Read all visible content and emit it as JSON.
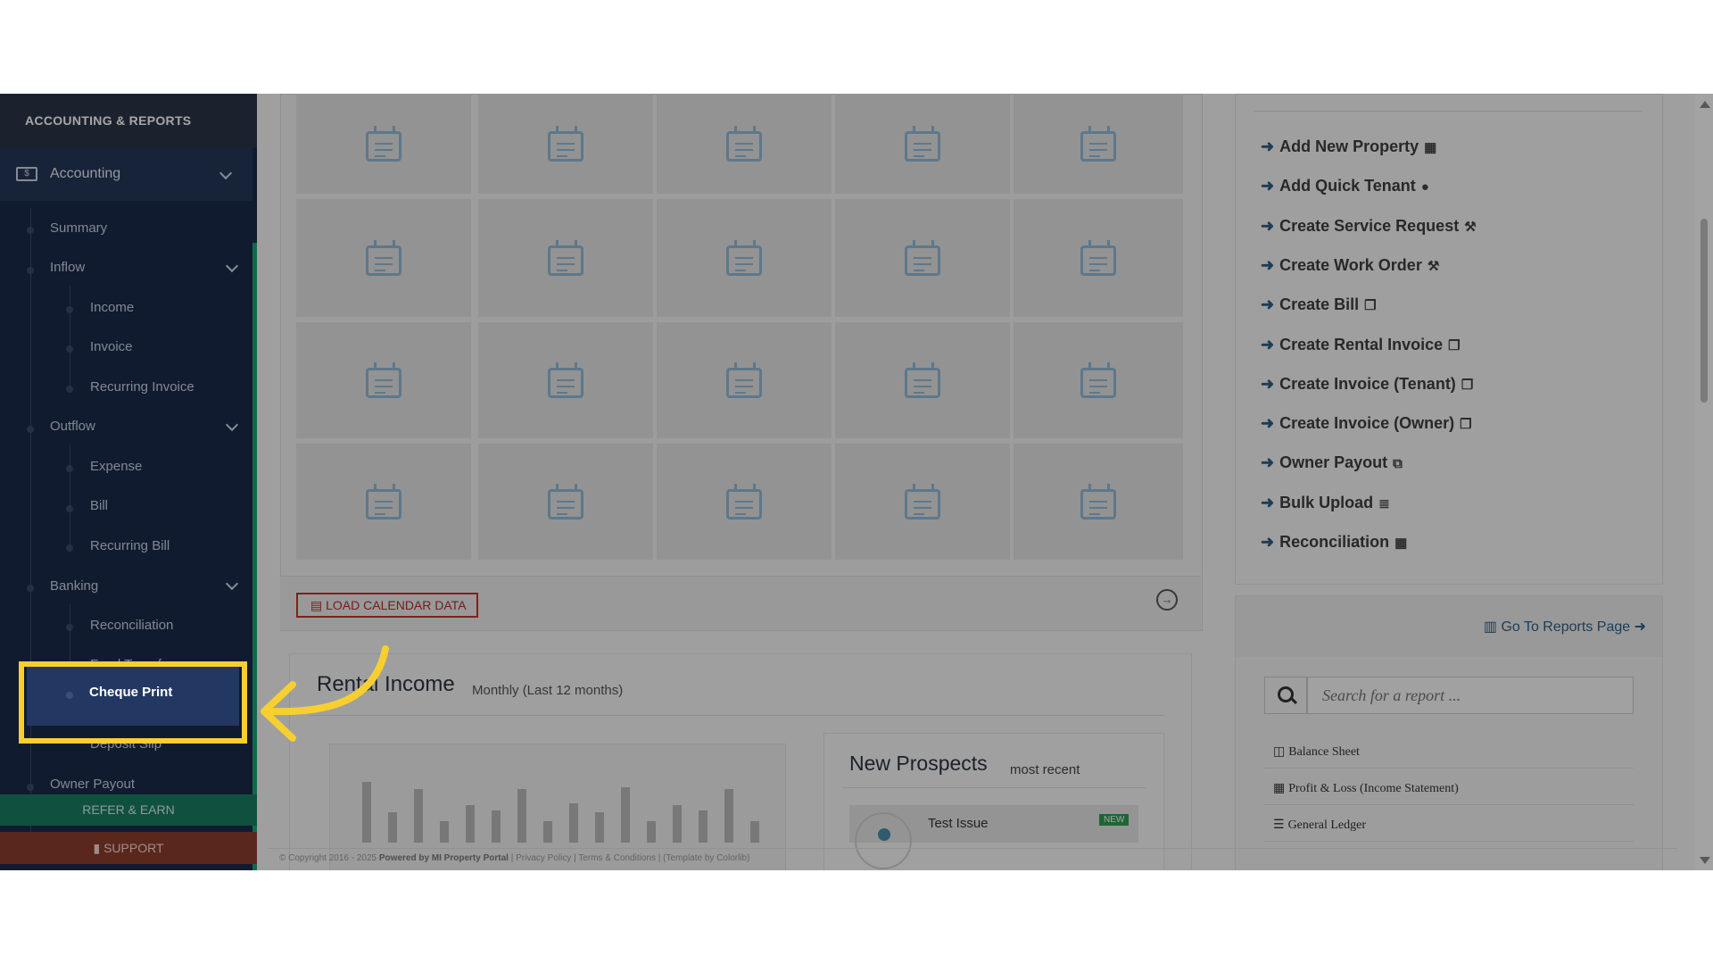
{
  "sidebar": {
    "header": "ACCOUNTING & REPORTS",
    "accounting_label": "Accounting",
    "items": [
      {
        "label": "Summary"
      },
      {
        "label": "Inflow"
      },
      {
        "label": "Income"
      },
      {
        "label": "Invoice"
      },
      {
        "label": "Recurring Invoice"
      },
      {
        "label": "Outflow"
      },
      {
        "label": "Expense"
      },
      {
        "label": "Bill"
      },
      {
        "label": "Recurring Bill"
      },
      {
        "label": "Banking"
      },
      {
        "label": "Reconciliation"
      },
      {
        "label": "Fund Transfers"
      },
      {
        "label": "Cheque Print"
      },
      {
        "label": "Deposit Slip"
      },
      {
        "label": "Owner Payout"
      }
    ],
    "refer_label": "REFER & EARN",
    "support_label": "SUPPORT"
  },
  "calendar": {
    "load_button_label": "LOAD CALENDAR DATA",
    "icons": "calendar-icon"
  },
  "rental_income": {
    "title": "Rental Income",
    "subtitle": "Monthly (Last 12 months)",
    "bar_levels": [
      0.85,
      0.42,
      0.75,
      0.3,
      0.52,
      0.45,
      0.75,
      0.3,
      0.55,
      0.42,
      0.78,
      0.3,
      0.52,
      0.45,
      0.75,
      0.3
    ]
  },
  "prospects": {
    "title": "New Prospects",
    "subtitle": "most recent",
    "item_title": "Test Issue",
    "badge": "NEW"
  },
  "quick_links": [
    {
      "label": "Add New Property",
      "icon": "building-icon",
      "symbol": "▦"
    },
    {
      "label": "Add Quick Tenant",
      "icon": "user-icon",
      "symbol": "●"
    },
    {
      "label": "Create Service Request",
      "icon": "wrench-icon",
      "symbol": "⚒"
    },
    {
      "label": "Create Work Order",
      "icon": "wrench-icon",
      "symbol": "⚒"
    },
    {
      "label": "Create Bill",
      "icon": "copy-icon",
      "symbol": "❐"
    },
    {
      "label": "Create Rental Invoice",
      "icon": "copy-icon",
      "symbol": "❐"
    },
    {
      "label": "Create Invoice (Tenant)",
      "icon": "copy-icon",
      "symbol": "❐"
    },
    {
      "label": "Create Invoice (Owner)",
      "icon": "copy-icon",
      "symbol": "❐"
    },
    {
      "label": "Owner Payout",
      "icon": "copy-outline-icon",
      "symbol": "⧉"
    },
    {
      "label": "Bulk Upload",
      "icon": "database-icon",
      "symbol": "≣"
    },
    {
      "label": "Reconciliation",
      "icon": "calculator-icon",
      "symbol": "▦"
    }
  ],
  "reports": {
    "link_label": "Go To Reports Page",
    "search_placeholder": "Search for a report ...",
    "items": [
      {
        "label": "Balance Sheet",
        "symbol": "◫"
      },
      {
        "label": "Profit & Loss (Income Statement)",
        "symbol": "▦"
      },
      {
        "label": "General Ledger",
        "symbol": "☰"
      }
    ]
  },
  "footer": {
    "copyright": "© Copyright 2016 - 2025",
    "powered": "Powered by MI Property Portal",
    "links": "| Privacy Policy | Terms & Conditions | (Template by Colorlib)"
  },
  "colors": {
    "sidebar_bg": "#1b2a49",
    "accent_green": "#1e9f74",
    "highlight_yellow": "#f7cf31",
    "button_red": "#c9302c",
    "link_blue": "#2d5f85"
  }
}
